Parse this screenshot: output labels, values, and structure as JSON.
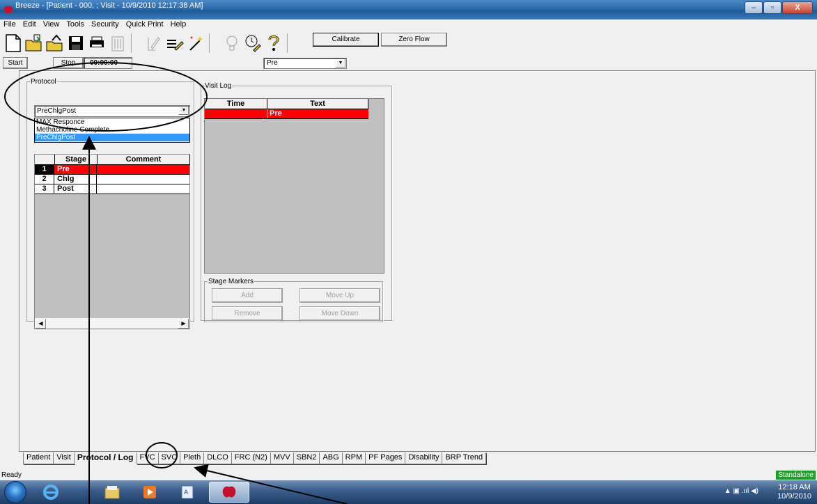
{
  "window": {
    "title": "Breeze - [Patient - 000, ;  Visit - 10/9/2010 12:17:38 AM]",
    "controls": [
      "–",
      "▫",
      "X"
    ]
  },
  "menu": [
    "File",
    "Edit",
    "View",
    "Tools",
    "Security",
    "Quick Print",
    "Help"
  ],
  "toolbar": {
    "icons": [
      "new-document-icon",
      "open-folder-icon",
      "folder-export-icon",
      "save-disk-icon",
      "print-icon",
      "trash-icon",
      "edit-pencil-icon",
      "notes-icon",
      "magic-wand-icon",
      "lightbulb-icon",
      "clock-pencil-icon",
      "help-question-icon"
    ],
    "calibrate_label": "Calibrate",
    "zero_flow_label": "Zero Flow"
  },
  "controls": {
    "start_label": "Start",
    "stop_label": "Stop",
    "timer": "00:00:00",
    "stage_value": "Pre"
  },
  "protocol": {
    "legend": "Protocol",
    "selected": "PreChlgPost",
    "options": [
      "MAX Responce",
      "Methacholine Complete",
      "PreChlgPost"
    ],
    "headers": [
      "Stage",
      "Comment"
    ],
    "rows": [
      {
        "num": "1",
        "stage": "Pre"
      },
      {
        "num": "2",
        "stage": "Chlg"
      },
      {
        "num": "3",
        "stage": "Post"
      }
    ]
  },
  "visit_log": {
    "legend": "Visit Log",
    "headers": [
      "Time",
      "Text"
    ],
    "rows": [
      {
        "time": "",
        "text": "Pre"
      }
    ],
    "stage_markers": {
      "legend": "Stage Markers",
      "add": "Add",
      "move_up": "Move Up",
      "remove": "Remove",
      "move_down": "Move Down"
    }
  },
  "tabs": [
    "Patient",
    "Visit",
    "Protocol / Log",
    "FVC",
    "SVC",
    "Pleth",
    "DLCO",
    "FRC (N2)",
    "MVV",
    "SBN2",
    "ABG",
    "RPM",
    "PF Pages",
    "Disability",
    "BRP Trend"
  ],
  "active_tab": "Protocol / Log",
  "status": {
    "left": "Ready",
    "right": "Standalone"
  },
  "taskbar": {
    "time": "12:18 AM",
    "date": "10/9/2010"
  },
  "colors": {
    "active_row": "#ff0000",
    "selection": "#3399ff",
    "standalone": "#1e9c2c"
  }
}
